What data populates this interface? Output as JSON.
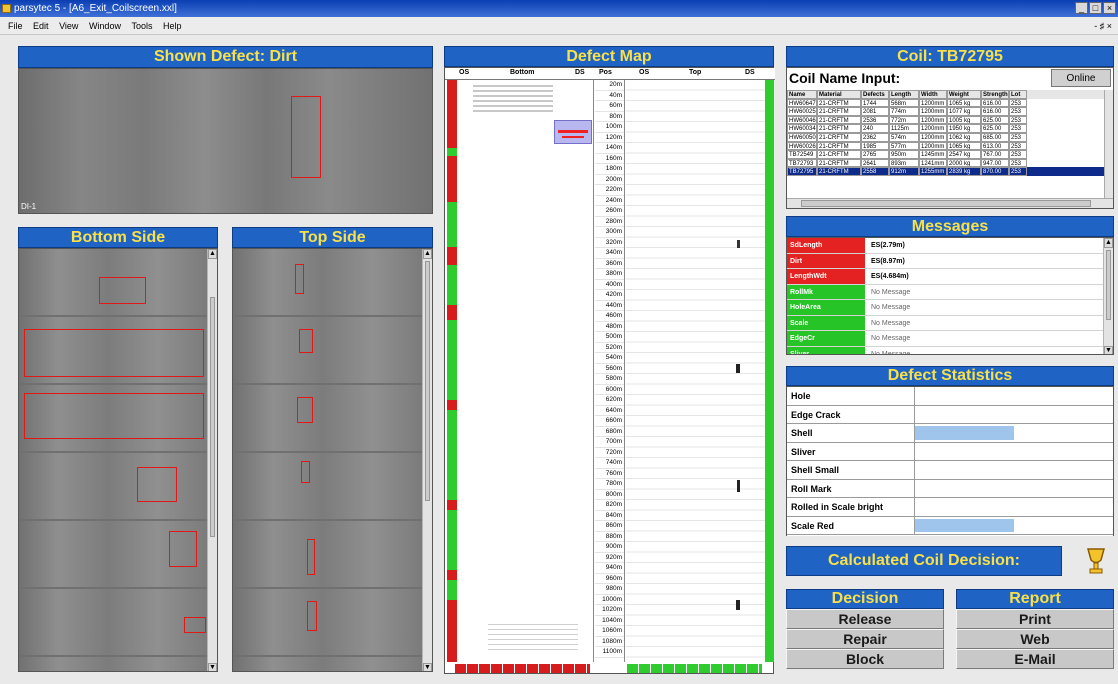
{
  "window": {
    "title": "parsytec 5 - [A6_Exit_Coilscreen.xxl]",
    "controls": [
      "_",
      "□",
      "×"
    ]
  },
  "menu": {
    "items": [
      "File",
      "Edit",
      "View",
      "Window",
      "Tools",
      "Help"
    ],
    "right": "- ♯ ×"
  },
  "shown_defect": {
    "title": "Shown Defect: Dirt",
    "image_label": "DI-1"
  },
  "bottom_side": {
    "title": "Bottom Side"
  },
  "top_side": {
    "title": "Top Side"
  },
  "defect_map": {
    "title": "Defect Map",
    "headers": [
      "OS",
      "Bottom",
      "DS",
      "Pos",
      "OS",
      "Top",
      "DS"
    ],
    "positions": [
      "20m",
      "40m",
      "60m",
      "80m",
      "100m",
      "120m",
      "140m",
      "160m",
      "180m",
      "200m",
      "220m",
      "240m",
      "260m",
      "280m",
      "300m",
      "320m",
      "340m",
      "360m",
      "380m",
      "400m",
      "420m",
      "440m",
      "460m",
      "480m",
      "500m",
      "520m",
      "540m",
      "560m",
      "580m",
      "600m",
      "620m",
      "640m",
      "660m",
      "680m",
      "700m",
      "720m",
      "740m",
      "760m",
      "780m",
      "800m",
      "820m",
      "840m",
      "860m",
      "880m",
      "900m",
      "920m",
      "940m",
      "960m",
      "980m",
      "1000m",
      "1020m",
      "1040m",
      "1060m",
      "1080m",
      "1100m"
    ]
  },
  "coil": {
    "title": "Coil: TB72795",
    "name_input_label": "Coil Name Input:",
    "online_button": "Online",
    "columns": [
      "Name",
      "Material",
      "Defects",
      "Length",
      "Width",
      "Weight",
      "Strength",
      "Lot"
    ],
    "rows": [
      [
        "HW60647",
        "21-CRFTM",
        "1744",
        "568m",
        "1200mm",
        "1065 kg",
        "616.00",
        "253"
      ],
      [
        "HW60025",
        "21-CRFTM",
        "2081",
        "774m",
        "1200mm",
        "1077 kg",
        "616.00",
        "253"
      ],
      [
        "HW60046",
        "21-CRFTM",
        "2536",
        "772m",
        "1200mm",
        "1005 kg",
        "625.00",
        "253"
      ],
      [
        "HW60034",
        "21-CRFTM",
        "240",
        "1125m",
        "1200mm",
        "1950 kg",
        "625.00",
        "253"
      ],
      [
        "HW60050",
        "21-CRFTM",
        "2362",
        "574m",
        "1200mm",
        "1062 kg",
        "685.00",
        "253"
      ],
      [
        "HW60026",
        "21-CRFTM",
        "1985",
        "577m",
        "1200mm",
        "1065 kg",
        "613.00",
        "253"
      ],
      [
        "TB72549",
        "21-CRFTM",
        "2765",
        "950m",
        "1245mm",
        "2547 kg",
        "767.00",
        "253"
      ],
      [
        "TB72793",
        "21-CRFTM",
        "2641",
        "893m",
        "1241mm",
        "2000 kg",
        "947.00",
        "253"
      ],
      [
        "TB72795",
        "21-CRFTM",
        "2558",
        "912m",
        "1255mm",
        "2839 kg",
        "870.00",
        "253"
      ]
    ]
  },
  "messages": {
    "title": "Messages",
    "rows": [
      {
        "key": "SdLength",
        "value": "ES(2.79m)",
        "color": "#e52222"
      },
      {
        "key": "Dirt",
        "value": "ES(8.97m)",
        "color": "#e52222"
      },
      {
        "key": "LengthWdt",
        "value": "ES(4.684m)",
        "color": "#e52222"
      },
      {
        "key": "RollMk",
        "value": "No Message",
        "color": "#26c426"
      },
      {
        "key": "HoleArea",
        "value": "No Message",
        "color": "#26c426"
      },
      {
        "key": "Scale",
        "value": "No Message",
        "color": "#26c426"
      },
      {
        "key": "EdgeCr",
        "value": "No Message",
        "color": "#26c426"
      },
      {
        "key": "Sliver",
        "value": "No Message",
        "color": "#26c426"
      }
    ]
  },
  "defect_statistics": {
    "title": "Defect Statistics",
    "rows": [
      {
        "name": "Hole",
        "level": 0
      },
      {
        "name": "Edge Crack",
        "level": 0
      },
      {
        "name": "Shell",
        "level": 0.5
      },
      {
        "name": "Sliver",
        "level": 0
      },
      {
        "name": "Shell Small",
        "level": 0
      },
      {
        "name": "Roll Mark",
        "level": 0
      },
      {
        "name": "Rolled in Scale bright",
        "level": 0
      },
      {
        "name": "Scale Red",
        "level": 0.5
      }
    ]
  },
  "calculated": {
    "label": "Calculated Coil Decision:",
    "icon": "trophy-icon"
  },
  "decision": {
    "title": "Decision",
    "buttons": [
      "Release",
      "Repair",
      "Block"
    ]
  },
  "report": {
    "title": "Report",
    "buttons": [
      "Print",
      "Web",
      "E-Mail"
    ]
  }
}
